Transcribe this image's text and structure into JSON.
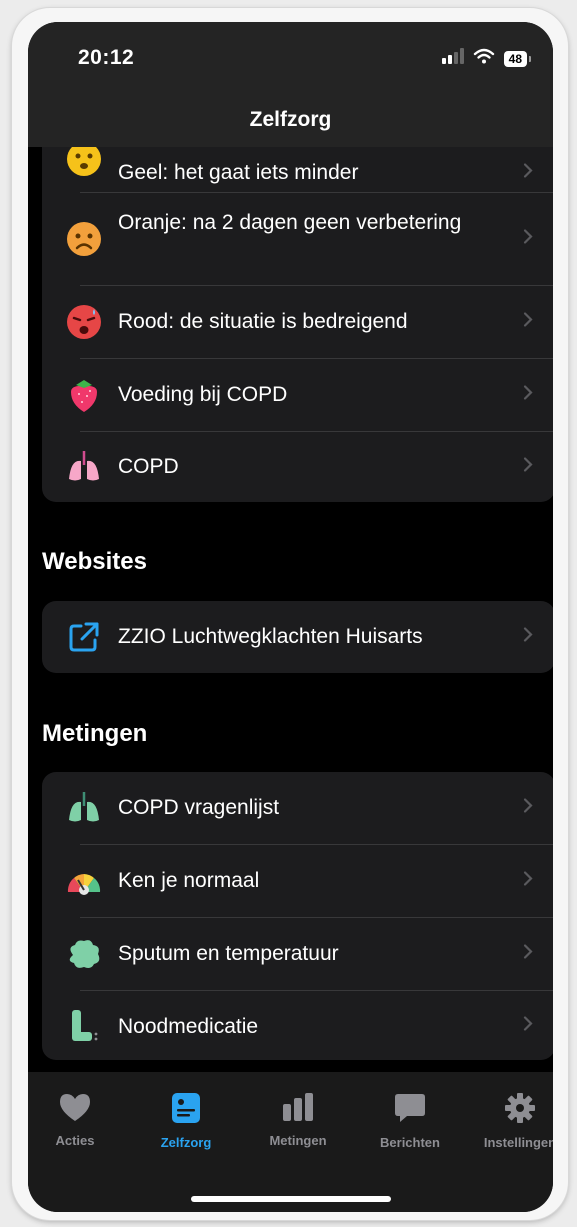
{
  "status_bar": {
    "time": "20:12",
    "battery": "48"
  },
  "nav": {
    "title": "Zelfzorg"
  },
  "zelfzorg_items": [
    {
      "label": "Geel: het gaat iets minder",
      "icon": "yellow-face-icon"
    },
    {
      "label": "Oranje: na 2 dagen geen verbetering",
      "icon": "orange-frown-face-icon"
    },
    {
      "label": "Rood: de situatie is bedreigend",
      "icon": "red-anxious-face-icon"
    },
    {
      "label": "Voeding bij COPD",
      "icon": "strawberry-icon"
    },
    {
      "label": "COPD",
      "icon": "pink-lungs-icon"
    }
  ],
  "websites": {
    "title": "Websites",
    "items": [
      {
        "label": "ZZIO Luchtwegklachten Huisarts",
        "icon": "external-link-icon"
      }
    ]
  },
  "metingen": {
    "title": "Metingen",
    "items": [
      {
        "label": "COPD vragenlijst",
        "icon": "green-lungs-icon"
      },
      {
        "label": "Ken je normaal",
        "icon": "rainbow-gauge-icon"
      },
      {
        "label": "Sputum en temperatuur",
        "icon": "green-blob-icon"
      },
      {
        "label": "Noodmedicatie",
        "icon": "inhaler-icon"
      }
    ]
  },
  "tabs": [
    {
      "label": "Acties",
      "icon": "heart-icon",
      "active": false
    },
    {
      "label": "Zelfzorg",
      "icon": "selfcare-card-icon",
      "active": true
    },
    {
      "label": "Metingen",
      "icon": "bar-chart-icon",
      "active": false
    },
    {
      "label": "Berichten",
      "icon": "chat-bubble-icon",
      "active": false
    },
    {
      "label": "Instellingen",
      "icon": "gear-icon",
      "active": false
    }
  ],
  "colors": {
    "background": "#000000",
    "card": "#1c1c1e",
    "accent": "#2aa3f0",
    "inactive_tab": "#8e8e93"
  }
}
